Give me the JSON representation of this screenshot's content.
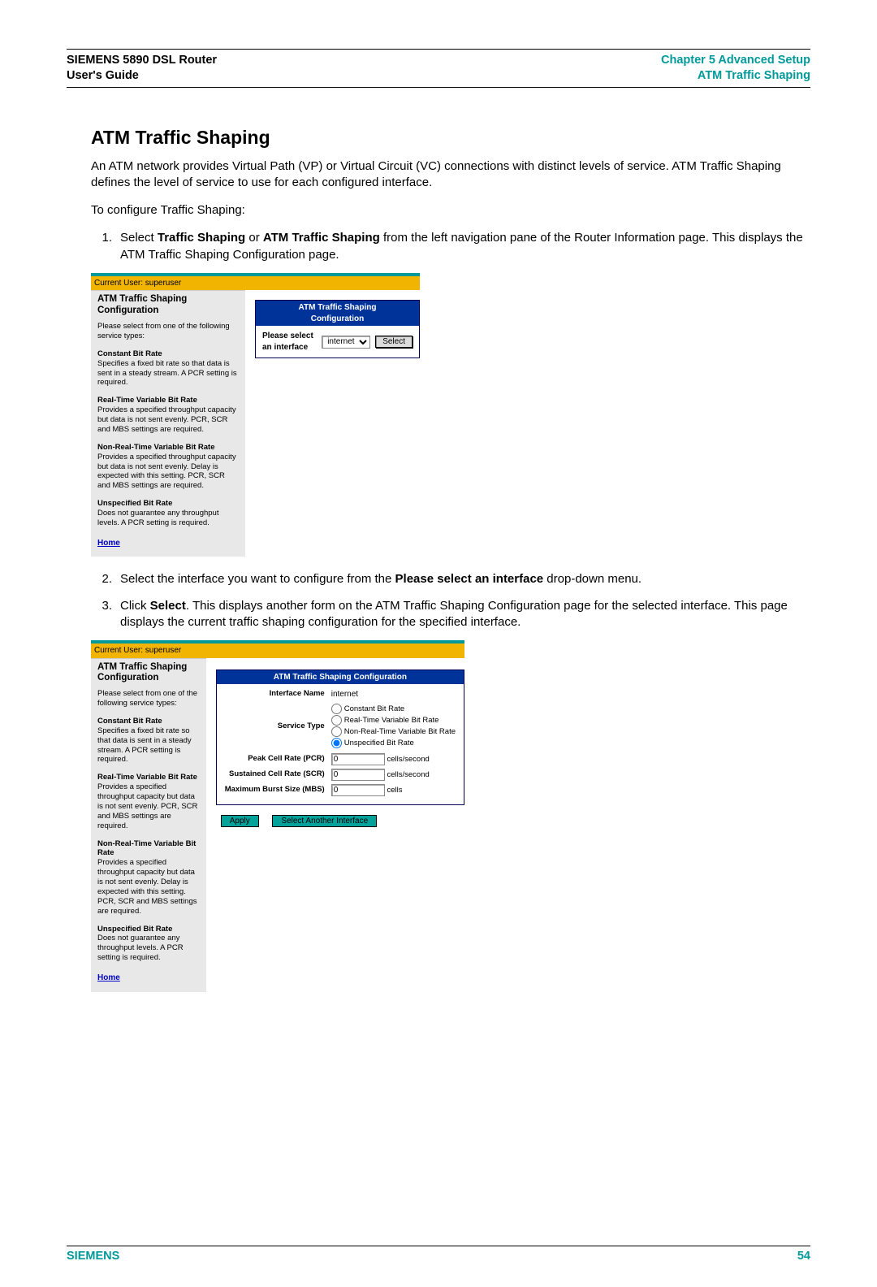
{
  "header": {
    "left_line1": "SIEMENS 5890 DSL Router",
    "left_line2": "User's Guide",
    "right_line1": "Chapter 5  Advanced Setup",
    "right_line2": "ATM Traffic Shaping"
  },
  "title": "ATM Traffic Shaping",
  "intro": "An ATM network provides Virtual Path (VP) or Virtual Circuit (VC) connections with distinct levels of service. ATM Traffic Shaping defines the level of service to use for each configured interface.",
  "lead": "To configure Traffic Shaping:",
  "step1": {
    "pre": "Select ",
    "b1": "Traffic Shaping",
    "mid": " or ",
    "b2": "ATM Traffic Shaping",
    "post": " from the left navigation pane of the Router Information page. This displays the ATM Traffic Shaping Configuration page."
  },
  "step2": {
    "pre": "Select the interface you want to configure from the ",
    "b1": "Please select an interface",
    "post": " drop-down menu."
  },
  "step3": {
    "pre": "Click ",
    "b1": "Select",
    "post": ". This displays another form on the ATM Traffic Shaping Configuration page for the selected interface. This page displays the current traffic shaping configuration for the specified interface."
  },
  "panel": {
    "current_user": "Current User: superuser",
    "title_l1": "ATM Traffic Shaping",
    "title_l2": "Configuration",
    "intro": "Please select from one of the following service types:",
    "cbr_h": "Constant Bit Rate",
    "cbr_d": "Specifies a fixed bit rate so that data is sent in a steady stream. A PCR setting is required.",
    "rt_h": "Real-Time Variable Bit Rate",
    "rt_d": "Provides a specified throughput capacity but data is not sent evenly. PCR, SCR and MBS settings are required.",
    "nrt_h": "Non-Real-Time Variable Bit Rate",
    "nrt_d": "Provides a specified throughput capacity but data is not sent evenly. Delay is expected with this setting. PCR, SCR and MBS settings are required.",
    "ubr_h": "Unspecified Bit Rate",
    "ubr_d": "Does not guarantee any throughput levels. A PCR setting is required.",
    "home": "Home",
    "cfg_title": "ATM Traffic Shaping Configuration",
    "select_label": "Please select an interface",
    "interface_value": "internet",
    "select_btn": "Select"
  },
  "panel2": {
    "iface_name_lbl": "Interface Name",
    "iface_name_val": "internet",
    "svc_type_lbl": "Service Type",
    "radios": {
      "cbr": "Constant Bit Rate",
      "rt": "Real-Time Variable Bit Rate",
      "nrt": "Non-Real-Time Variable Bit Rate",
      "ubr": "Unspecified Bit Rate"
    },
    "pcr_lbl": "Peak Cell Rate (PCR)",
    "pcr_val": "0",
    "pcr_unit": "cells/second",
    "scr_lbl": "Sustained Cell Rate (SCR)",
    "scr_val": "0",
    "scr_unit": "cells/second",
    "mbs_lbl": "Maximum Burst Size (MBS)",
    "mbs_val": "0",
    "mbs_unit": "cells",
    "apply": "Apply",
    "another": "Select Another Interface"
  },
  "footer": {
    "brand": "SIEMENS",
    "page": "54"
  }
}
